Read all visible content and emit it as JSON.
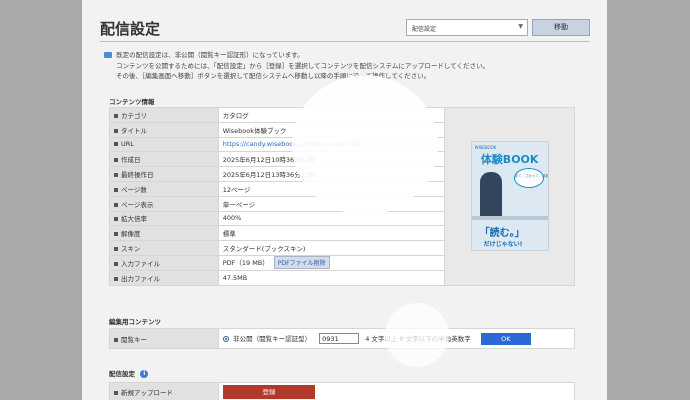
{
  "header": {
    "title": "配信設定",
    "select_value": "配信設定",
    "move_button": "移動"
  },
  "notice": {
    "line1": "既定の配信設定は、非公開（閲覧キー認証形）になっています。",
    "line2": "コンテンツを公開するためには、「配信設定」から［登録］を選択してコンテンツを配信システムにアップロードしてください。",
    "line3": "その後、［編集画面へ移動］ボタンを選択して配信システムへ移動し以降の手順に沿って操作してください。"
  },
  "content_info": {
    "heading": "コンテンツ情報",
    "rows": [
      {
        "label": "カテゴリ",
        "value": "カタログ"
      },
      {
        "label": "タイトル",
        "value": "Wisebook体験ブック"
      },
      {
        "label": "URL",
        "value": "https://candy.wisebook.jp/h5/Creative/752"
      },
      {
        "label": "作成日",
        "value": "2025年6月12日10時36分52秒"
      },
      {
        "label": "最終操作日",
        "value": "2025年6月12日13時36分21秒"
      },
      {
        "label": "ページ数",
        "value": "12ページ"
      },
      {
        "label": "ページ表示",
        "value": "単一ページ"
      },
      {
        "label": "拡大倍率",
        "value": "400%"
      },
      {
        "label": "解像度",
        "value": "標準"
      },
      {
        "label": "スキン",
        "value": "スタンダード(ブックスキン)"
      },
      {
        "label": "入力ファイル",
        "value": "PDF（19 MB）"
      },
      {
        "label": "出力ファイル",
        "value": "47.5MB"
      }
    ],
    "pdf_button": "PDFファイル削除"
  },
  "cover": {
    "brand": "WISEBOOK",
    "title": "体験BOOK",
    "bubble": "見て、さわって、体験する",
    "yomu": "「読む。」",
    "dake": "だけじゃない!"
  },
  "edit_content": {
    "heading": "編集用コンテンツ",
    "label": "閲覧キー",
    "radio_label": "非公開（閲覧キー認証型）",
    "key_value": "0931",
    "hint": "4 文字以上 8 文字以下の半角英数字",
    "ok_button": "OK"
  },
  "publish": {
    "heading": "配信設定",
    "label": "新規アップロード",
    "register_button": "登録"
  }
}
